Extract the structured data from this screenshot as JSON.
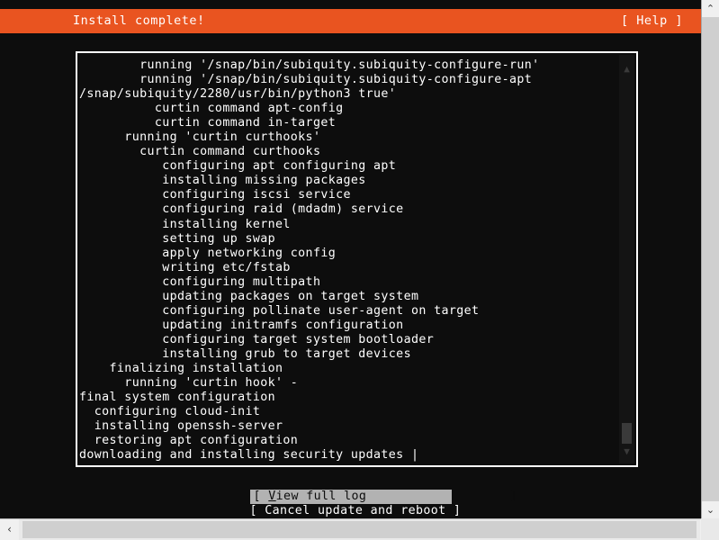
{
  "header": {
    "title": "Install complete!",
    "help_label": "[ Help ]",
    "bar_color": "#e95420"
  },
  "log": {
    "lines": [
      "        running '/snap/bin/subiquity.subiquity-configure-run'",
      "        running '/snap/bin/subiquity.subiquity-configure-apt",
      "/snap/subiquity/2280/usr/bin/python3 true'",
      "          curtin command apt-config",
      "          curtin command in-target",
      "      running 'curtin curthooks'",
      "        curtin command curthooks",
      "           configuring apt configuring apt",
      "           installing missing packages",
      "           configuring iscsi service",
      "           configuring raid (mdadm) service",
      "           installing kernel",
      "           setting up swap",
      "           apply networking config",
      "           writing etc/fstab",
      "           configuring multipath",
      "           updating packages on target system",
      "           configuring pollinate user-agent on target",
      "           updating initramfs configuration",
      "           configuring target system bootloader",
      "           installing grub to target devices",
      "    finalizing installation",
      "      running 'curtin hook' -",
      "final system configuration",
      "  configuring cloud-init",
      "  installing openssh-server",
      "  restoring apt configuration",
      "downloading and installing security updates |"
    ],
    "scrollbar": {
      "up_arrow": "▲",
      "down_arrow": "▼"
    }
  },
  "buttons": [
    {
      "label": "[ View full log                   ]",
      "accel": "V",
      "selected": true
    },
    {
      "label": "[ Cancel update and reboot ]",
      "accel": "",
      "selected": false
    }
  ],
  "window_scrollbars": {
    "v_up": "⌃",
    "v_down": "⌄",
    "h_left": "‹",
    "h_right": "›"
  }
}
